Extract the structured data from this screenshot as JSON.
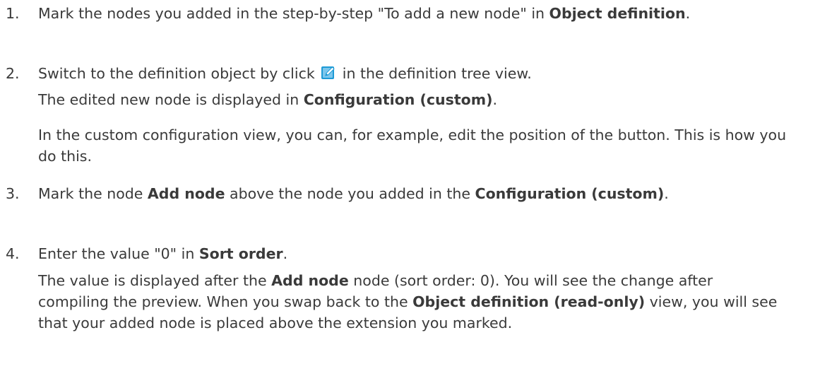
{
  "steps": [
    {
      "number": "1.",
      "t1": "Mark the nodes you added in the step-by-step \"To add a new node\" in ",
      "b1": "Object definition",
      "t2": "."
    },
    {
      "number": "2.",
      "t1": "Switch to the definition object by click ",
      "icon": "edit-icon",
      "t2": " in the definition tree view.",
      "p1_t1": "The edited new node is displayed in ",
      "p1_b1": "Configuration (custom)",
      "p1_t2": ".",
      "p2": "In the custom configuration view, you can, for example, edit the position of the button. This is how you do this."
    },
    {
      "number": "3.",
      "t1": "Mark the node ",
      "b1": "Add node",
      "t2": " above the node you added in the ",
      "b2": "Configuration (custom)",
      "t3": "."
    },
    {
      "number": "4.",
      "t1": "Enter the value \"0\" in ",
      "b1": "Sort order",
      "t2": ".",
      "p1_t1": "The value is displayed after the ",
      "p1_b1": "Add node",
      "p1_t2": " node (sort order: 0). You will see the change after compiling the preview. When you swap back to the ",
      "p1_b2": "Object definition (read-only)",
      "p1_t3": " view, you will see that your added node is placed above the extension you marked."
    }
  ],
  "colors": {
    "text": "#3a3a3a",
    "icon_primary": "#1e9ad6",
    "icon_pencil": "#ffffff"
  }
}
